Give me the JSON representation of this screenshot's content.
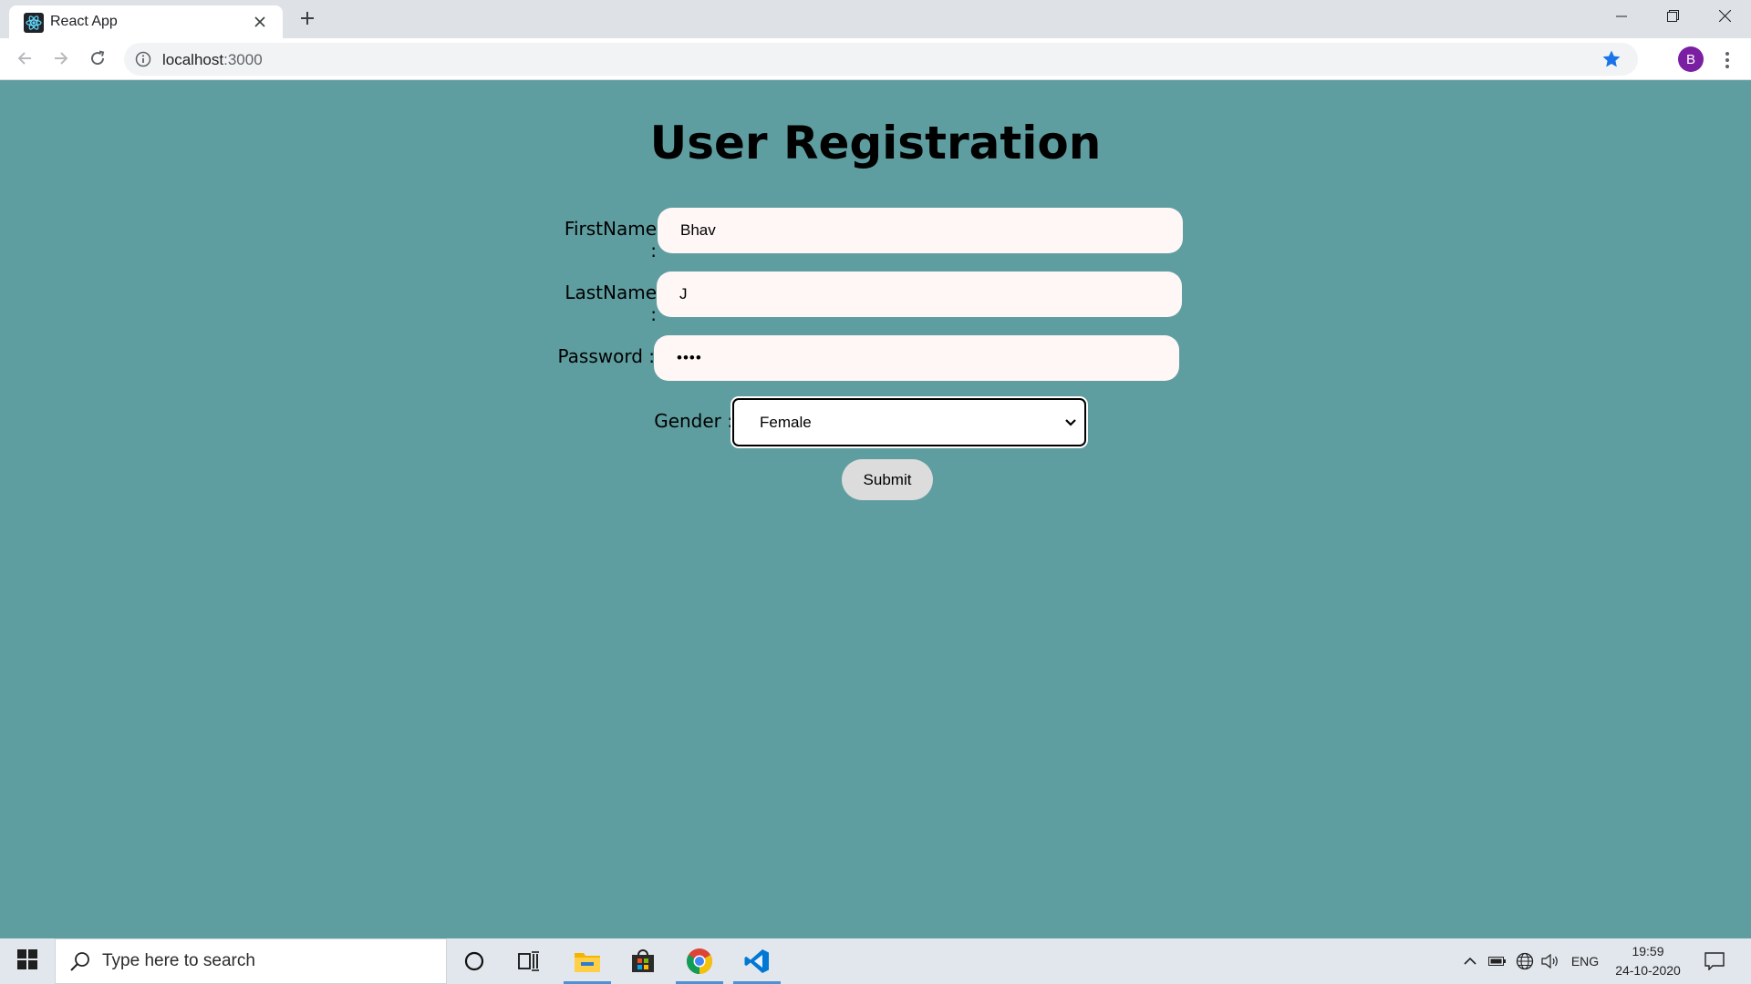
{
  "browser": {
    "tab_title": "React App",
    "url_host": "localhost",
    "url_port": ":3000",
    "profile_initial": "B",
    "icons": {
      "favicon": "react-icon",
      "close": "close-icon",
      "new_tab": "plus-icon",
      "back": "arrow-left-icon",
      "forward": "arrow-right-icon",
      "reload": "reload-icon",
      "info": "info-icon",
      "bookmark": "star-icon",
      "menu": "kebab-icon"
    }
  },
  "form": {
    "title": "User Registration",
    "firstname_label": "FirstName :",
    "firstname_value": "Bhav",
    "lastname_label": "LastName :",
    "lastname_value": "J",
    "password_label": "Password :",
    "password_value": "••••",
    "gender_label": "Gender :",
    "gender_value": "Female",
    "submit_label": "Submit"
  },
  "taskbar": {
    "search_placeholder": "Type here to search",
    "language": "ENG",
    "time": "19:59",
    "date": "24-10-2020",
    "apps": [
      "cortana-icon",
      "task-view-icon",
      "file-explorer-icon",
      "store-icon",
      "chrome-icon",
      "vscode-icon"
    ]
  },
  "colors": {
    "page_background": "#5f9ea0",
    "input_background": "#fff6f6",
    "submit_background": "#dcdcdc",
    "bookmark_star": "#1a73e8",
    "avatar": "#7b1fa2"
  }
}
